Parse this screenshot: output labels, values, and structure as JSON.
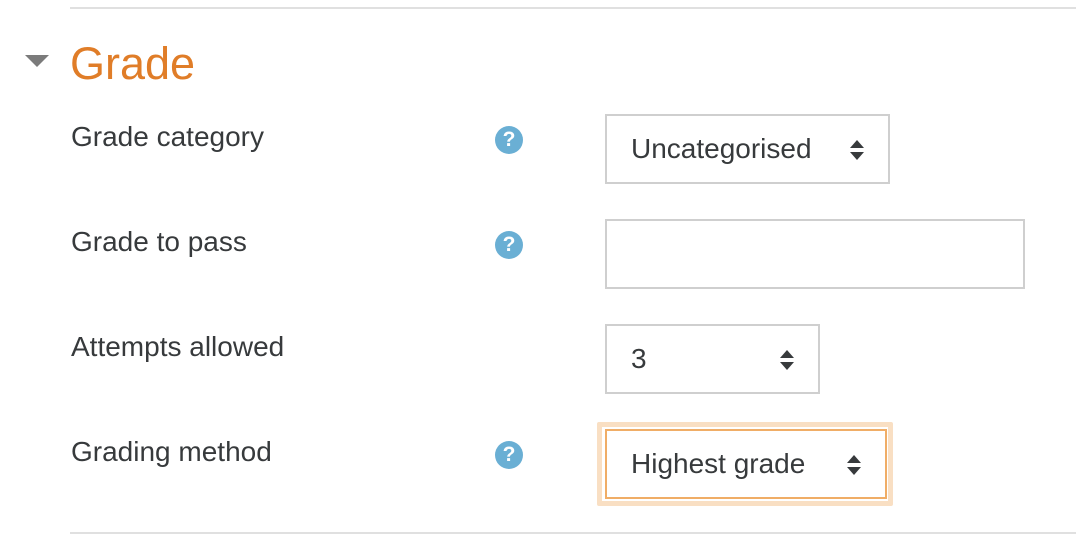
{
  "section": {
    "title": "Grade",
    "toggle_icon": "triangle-down-icon"
  },
  "fields": {
    "grade_category": {
      "label": "Grade category",
      "value": "Uncategorised",
      "help_icon": "question-icon",
      "help_glyph": "?"
    },
    "grade_to_pass": {
      "label": "Grade to pass",
      "value": "",
      "help_icon": "question-icon",
      "help_glyph": "?"
    },
    "attempts_allowed": {
      "label": "Attempts allowed",
      "value": "3"
    },
    "grading_method": {
      "label": "Grading method",
      "value": "Highest grade",
      "help_icon": "question-icon",
      "help_glyph": "?"
    }
  },
  "colors": {
    "section_title": "#e07d28",
    "help_icon": "#6aafd4",
    "focus_ring": "#f9dfc3"
  }
}
